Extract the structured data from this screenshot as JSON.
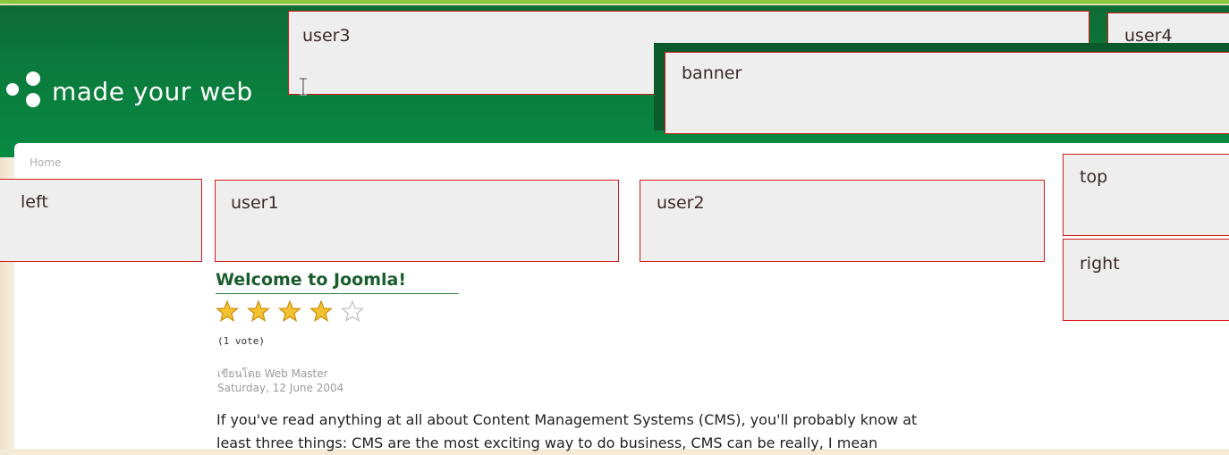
{
  "site": {
    "logo_text": "made your web"
  },
  "modules": {
    "user3": "user3",
    "user4": "user4",
    "banner": "banner",
    "left": "left",
    "user1": "user1",
    "user2": "user2",
    "top": "top",
    "right": "right"
  },
  "breadcrumb": {
    "home": "Home"
  },
  "article": {
    "title": "Welcome to Joomla!",
    "rating": {
      "filled_stars": 4,
      "total_stars": 5
    },
    "votes": "(1 vote)",
    "author": "เขียนโดย Web Master",
    "date": "Saturday, 12 June 2004",
    "body_line1": "If you've read anything at all about Content Management Systems (CMS), you'll probably know at",
    "body_line2": "least three things: CMS are the most exciting way to do business, CMS can be really, I mean"
  },
  "colors": {
    "header_green": "#0c7a3c",
    "module_border": "#d31a1a",
    "module_bg": "#eeeeee",
    "title_green": "#1a5c2e"
  }
}
